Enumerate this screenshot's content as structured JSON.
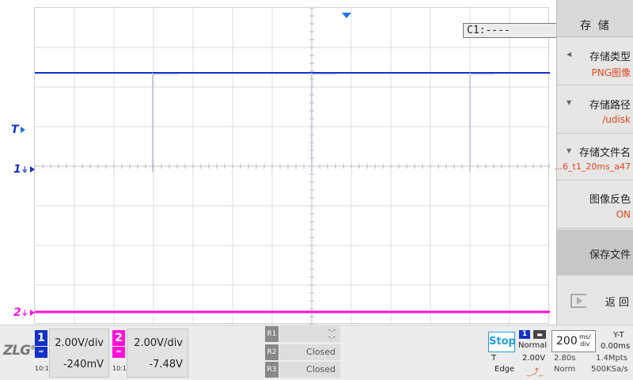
{
  "cursor_readout": "C1:----",
  "markers": {
    "trigger": "T",
    "channel1": "1",
    "channel2": "2"
  },
  "colors": {
    "channel1": "#1530c8",
    "channel2": "#ff10d8",
    "trigger_arrow": "#1a73e8",
    "menu_value": "#e2451c",
    "stop": "#1ea0e0"
  },
  "menu": {
    "title": "存 储",
    "items": [
      {
        "label": "存储类型",
        "value": "PNG图像",
        "icon": "triangle-left-icon"
      },
      {
        "label": "存储路径",
        "value": "/udisk",
        "icon": "triangle-down-icon"
      },
      {
        "label": "存储文件名",
        "value": "...6_t1_20ms_a47",
        "icon": "triangle-down-icon"
      },
      {
        "label": "图像反色",
        "value": "ON"
      },
      {
        "label": "保存文件",
        "value": ""
      },
      {
        "label": "返 回",
        "value": "",
        "icon": "back-icon"
      }
    ]
  },
  "bottom": {
    "logo": "ZLG",
    "logo_mark": "®",
    "ch1": {
      "num": "1",
      "ratio": "10:1",
      "scale": "2.00V/div",
      "offset": "-240mV",
      "coupling": "DC"
    },
    "ch2": {
      "num": "2",
      "ratio": "10:1",
      "scale": "2.00V/div",
      "offset": "-7.48V",
      "coupling": "DC"
    },
    "refs": [
      {
        "tag": "R1",
        "text": "-.-\n-.-"
      },
      {
        "tag": "R2",
        "text": "Closed"
      },
      {
        "tag": "R3",
        "text": "Closed"
      }
    ],
    "run_state": "Stop",
    "trigger": {
      "source": "1",
      "mode": "Normal",
      "type_label": "T",
      "level": "2.00V",
      "edge": "Edge"
    },
    "timebase": {
      "value": "200",
      "unit_top": "ms/",
      "unit_bottom": "div",
      "mode": "Y-T",
      "delay": "0.00ms"
    },
    "acq": {
      "length": "2.80s",
      "points": "1.4Mpts",
      "mode": "Norm",
      "rate": "500KSa/s"
    }
  }
}
